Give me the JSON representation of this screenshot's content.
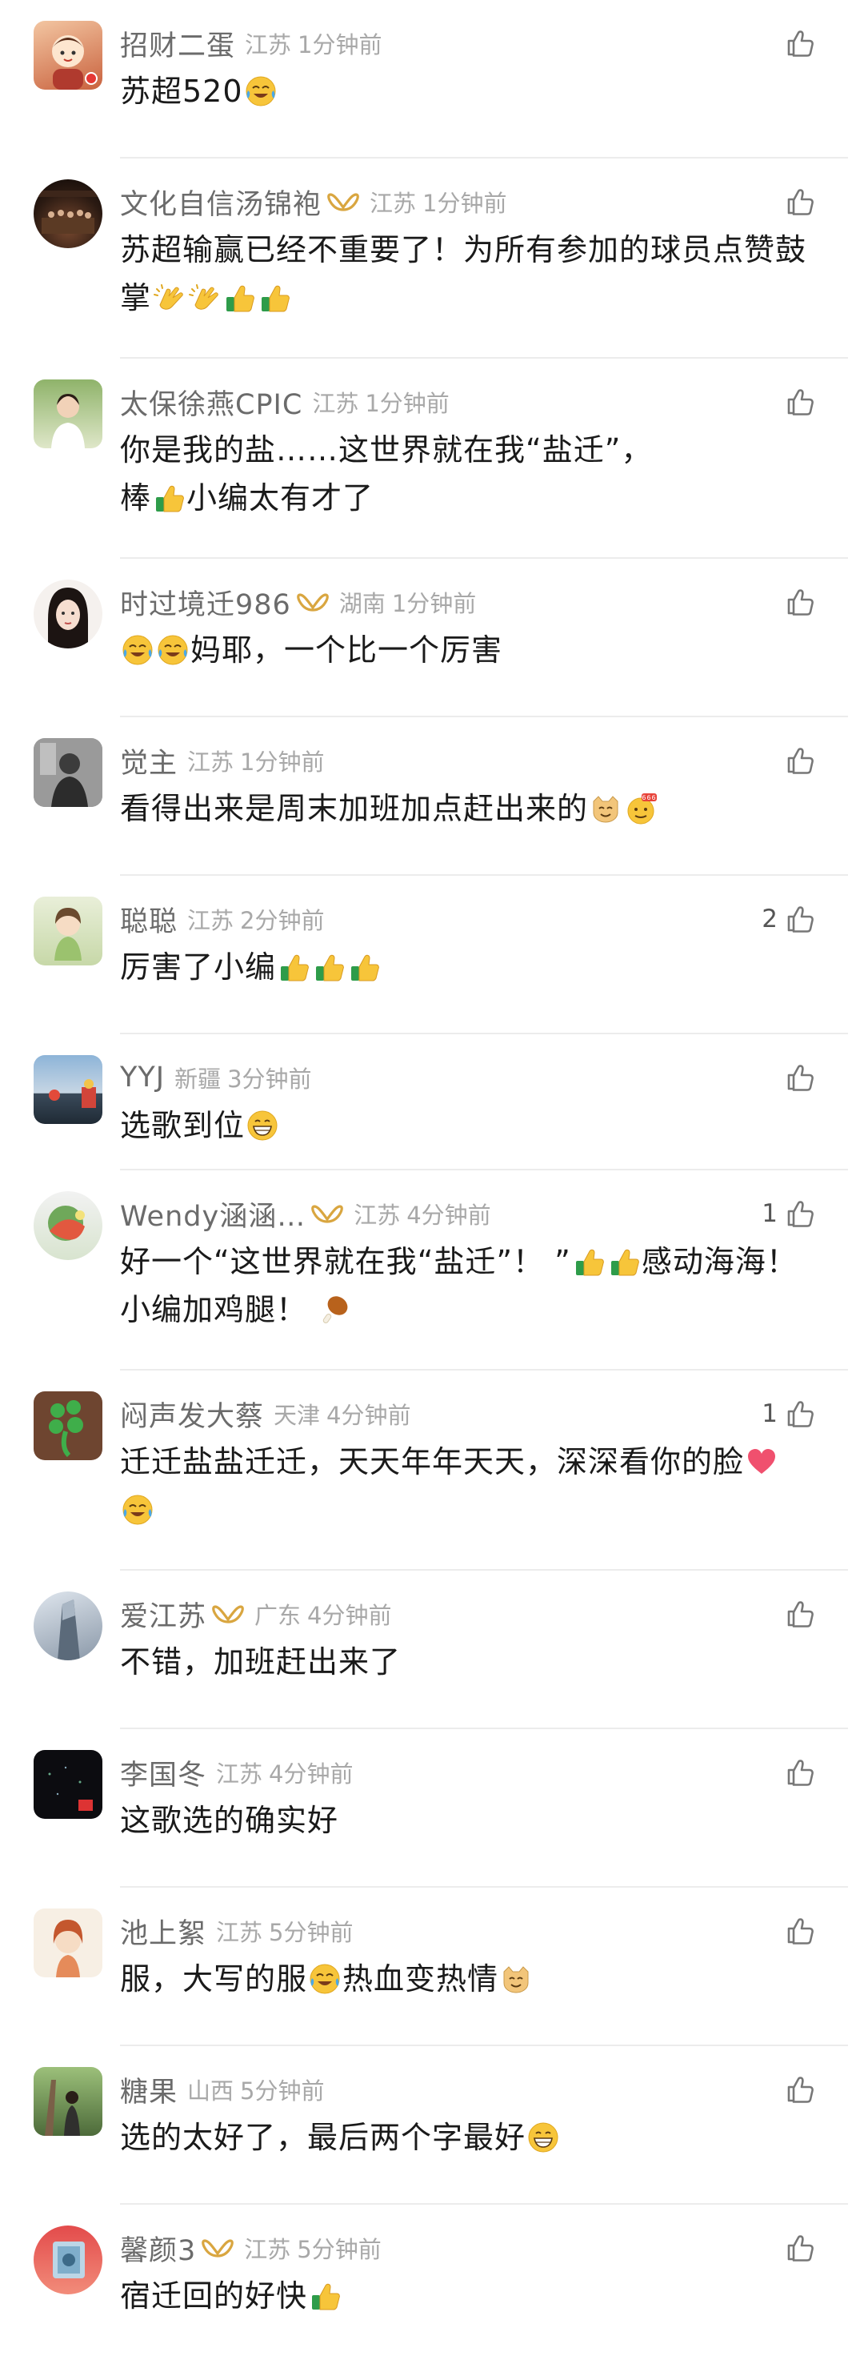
{
  "comments": [
    {
      "username": "招财二蛋",
      "vip": false,
      "region": "江苏",
      "time": "1分钟前",
      "text": "苏超520",
      "emojis": [
        "cry-laugh-emoji"
      ],
      "likes": ""
    },
    {
      "username": "文化自信汤锦袍",
      "vip": true,
      "region": "江苏",
      "time": "1分钟前",
      "text_line1": "苏超输赢已经不重要了！为所有参加的球员点赞鼓",
      "text_line2": "掌",
      "emojis": [
        "clap-emoji",
        "clap-emoji",
        "thumbs-up-emoji",
        "thumbs-up-emoji"
      ],
      "likes": ""
    },
    {
      "username": "太保徐燕CPIC",
      "vip": false,
      "region": "江苏",
      "time": "1分钟前",
      "text_line1": "你是我的盐……这世界就在我“盐迁”，",
      "text_line2a": "棒",
      "text_line2b": "小编太有才了",
      "emojis": [
        "thumbs-up-emoji"
      ],
      "likes": ""
    },
    {
      "username": "时过境迁986",
      "vip": true,
      "region": "湖南",
      "time": "1分钟前",
      "text": "妈耶，一个比一个厉害",
      "emojis": [
        "cry-laugh-emoji",
        "cry-laugh-emoji"
      ],
      "likes": ""
    },
    {
      "username": "觉主",
      "vip": false,
      "region": "江苏",
      "time": "1分钟前",
      "text": "看得出来是周末加班加点赶出来的",
      "emojis": [
        "cat-emoji",
        "666-emoji"
      ],
      "likes": ""
    },
    {
      "username": "聪聪",
      "vip": false,
      "region": "江苏",
      "time": "2分钟前",
      "text": "厉害了小编",
      "emojis": [
        "thumbs-up-emoji",
        "thumbs-up-emoji",
        "thumbs-up-emoji"
      ],
      "likes": "2"
    },
    {
      "username": "YYJ",
      "vip": false,
      "region": "新疆",
      "time": "3分钟前",
      "text": "选歌到位",
      "emojis": [
        "grin-emoji"
      ],
      "likes": ""
    },
    {
      "username": "Wendy涵涵…",
      "vip": true,
      "region": "江苏",
      "time": "4分钟前",
      "text_line1a": "好一个“这世界就在我“盐迁”！ ”",
      "text_line1b": "感动海海！",
      "text_line2": "小编加鸡腿！",
      "emojis": [
        "thumbs-up-emoji",
        "thumbs-up-emoji",
        "drumstick-emoji"
      ],
      "likes": "1"
    },
    {
      "username": "闷声发大蔡",
      "vip": false,
      "region": "天津",
      "time": "4分钟前",
      "text": "迁迁盐盐迁迁，天天年年天天，深深看你的脸",
      "emojis": [
        "heart-emoji",
        "cry-laugh-emoji"
      ],
      "likes": "1"
    },
    {
      "username": "爱江苏",
      "vip": true,
      "region": "广东",
      "time": "4分钟前",
      "text": "不错，加班赶出来了",
      "emojis": [],
      "likes": ""
    },
    {
      "username": "李国冬",
      "vip": false,
      "region": "江苏",
      "time": "4分钟前",
      "text": "这歌选的确实好",
      "emojis": [],
      "likes": ""
    },
    {
      "username": "池上絮",
      "vip": false,
      "region": "江苏",
      "time": "5分钟前",
      "text_a": "服，大写的服",
      "text_b": "热血变热情",
      "emojis": [
        "cry-laugh-emoji",
        "cat-emoji"
      ],
      "likes": ""
    },
    {
      "username": "糖果",
      "vip": false,
      "region": "山西",
      "time": "5分钟前",
      "text": "选的太好了，最后两个字最好",
      "emojis": [
        "grin-emoji"
      ],
      "likes": ""
    },
    {
      "username": "馨颜3",
      "vip": true,
      "region": "江苏",
      "time": "5分钟前",
      "text": "宿迁回的好快",
      "emojis": [
        "thumbs-up-emoji"
      ],
      "likes": ""
    }
  ],
  "colors": {
    "username": "#6b6b6b",
    "meta": "#a8a8a8",
    "text": "#1a1a1a",
    "vip_gold": "#d9a640",
    "divider": "#ececec",
    "like_icon": "#777777"
  }
}
